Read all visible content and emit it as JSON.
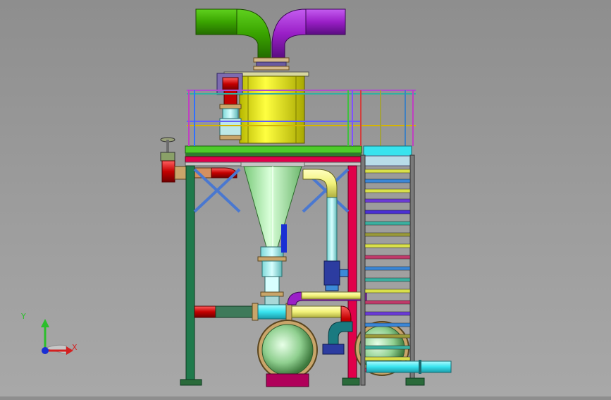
{
  "view": {
    "background": "#9a9a9a"
  },
  "triad": {
    "y_label": "Y",
    "x_label": "X",
    "colors": {
      "x": "#d42020",
      "y": "#2bbf2b",
      "z": "#1a2fd4"
    }
  },
  "model": {
    "colors": {
      "pipe_green": "#39a800",
      "pipe_purple": "#9a1fc7",
      "vessel_yellow": "#e6e600",
      "cone_green": "#a8f0a8",
      "frame_red": "#e0004a",
      "frame_green": "#1f7a4c",
      "platform_green": "#4ecb2a",
      "pipe_red": "#c40000",
      "pipe_cyan": "#38e3ee",
      "tank_green": "#8fcf8f",
      "flange_tan": "#c9a56a",
      "stair_blue": "#3b86d6"
    }
  }
}
